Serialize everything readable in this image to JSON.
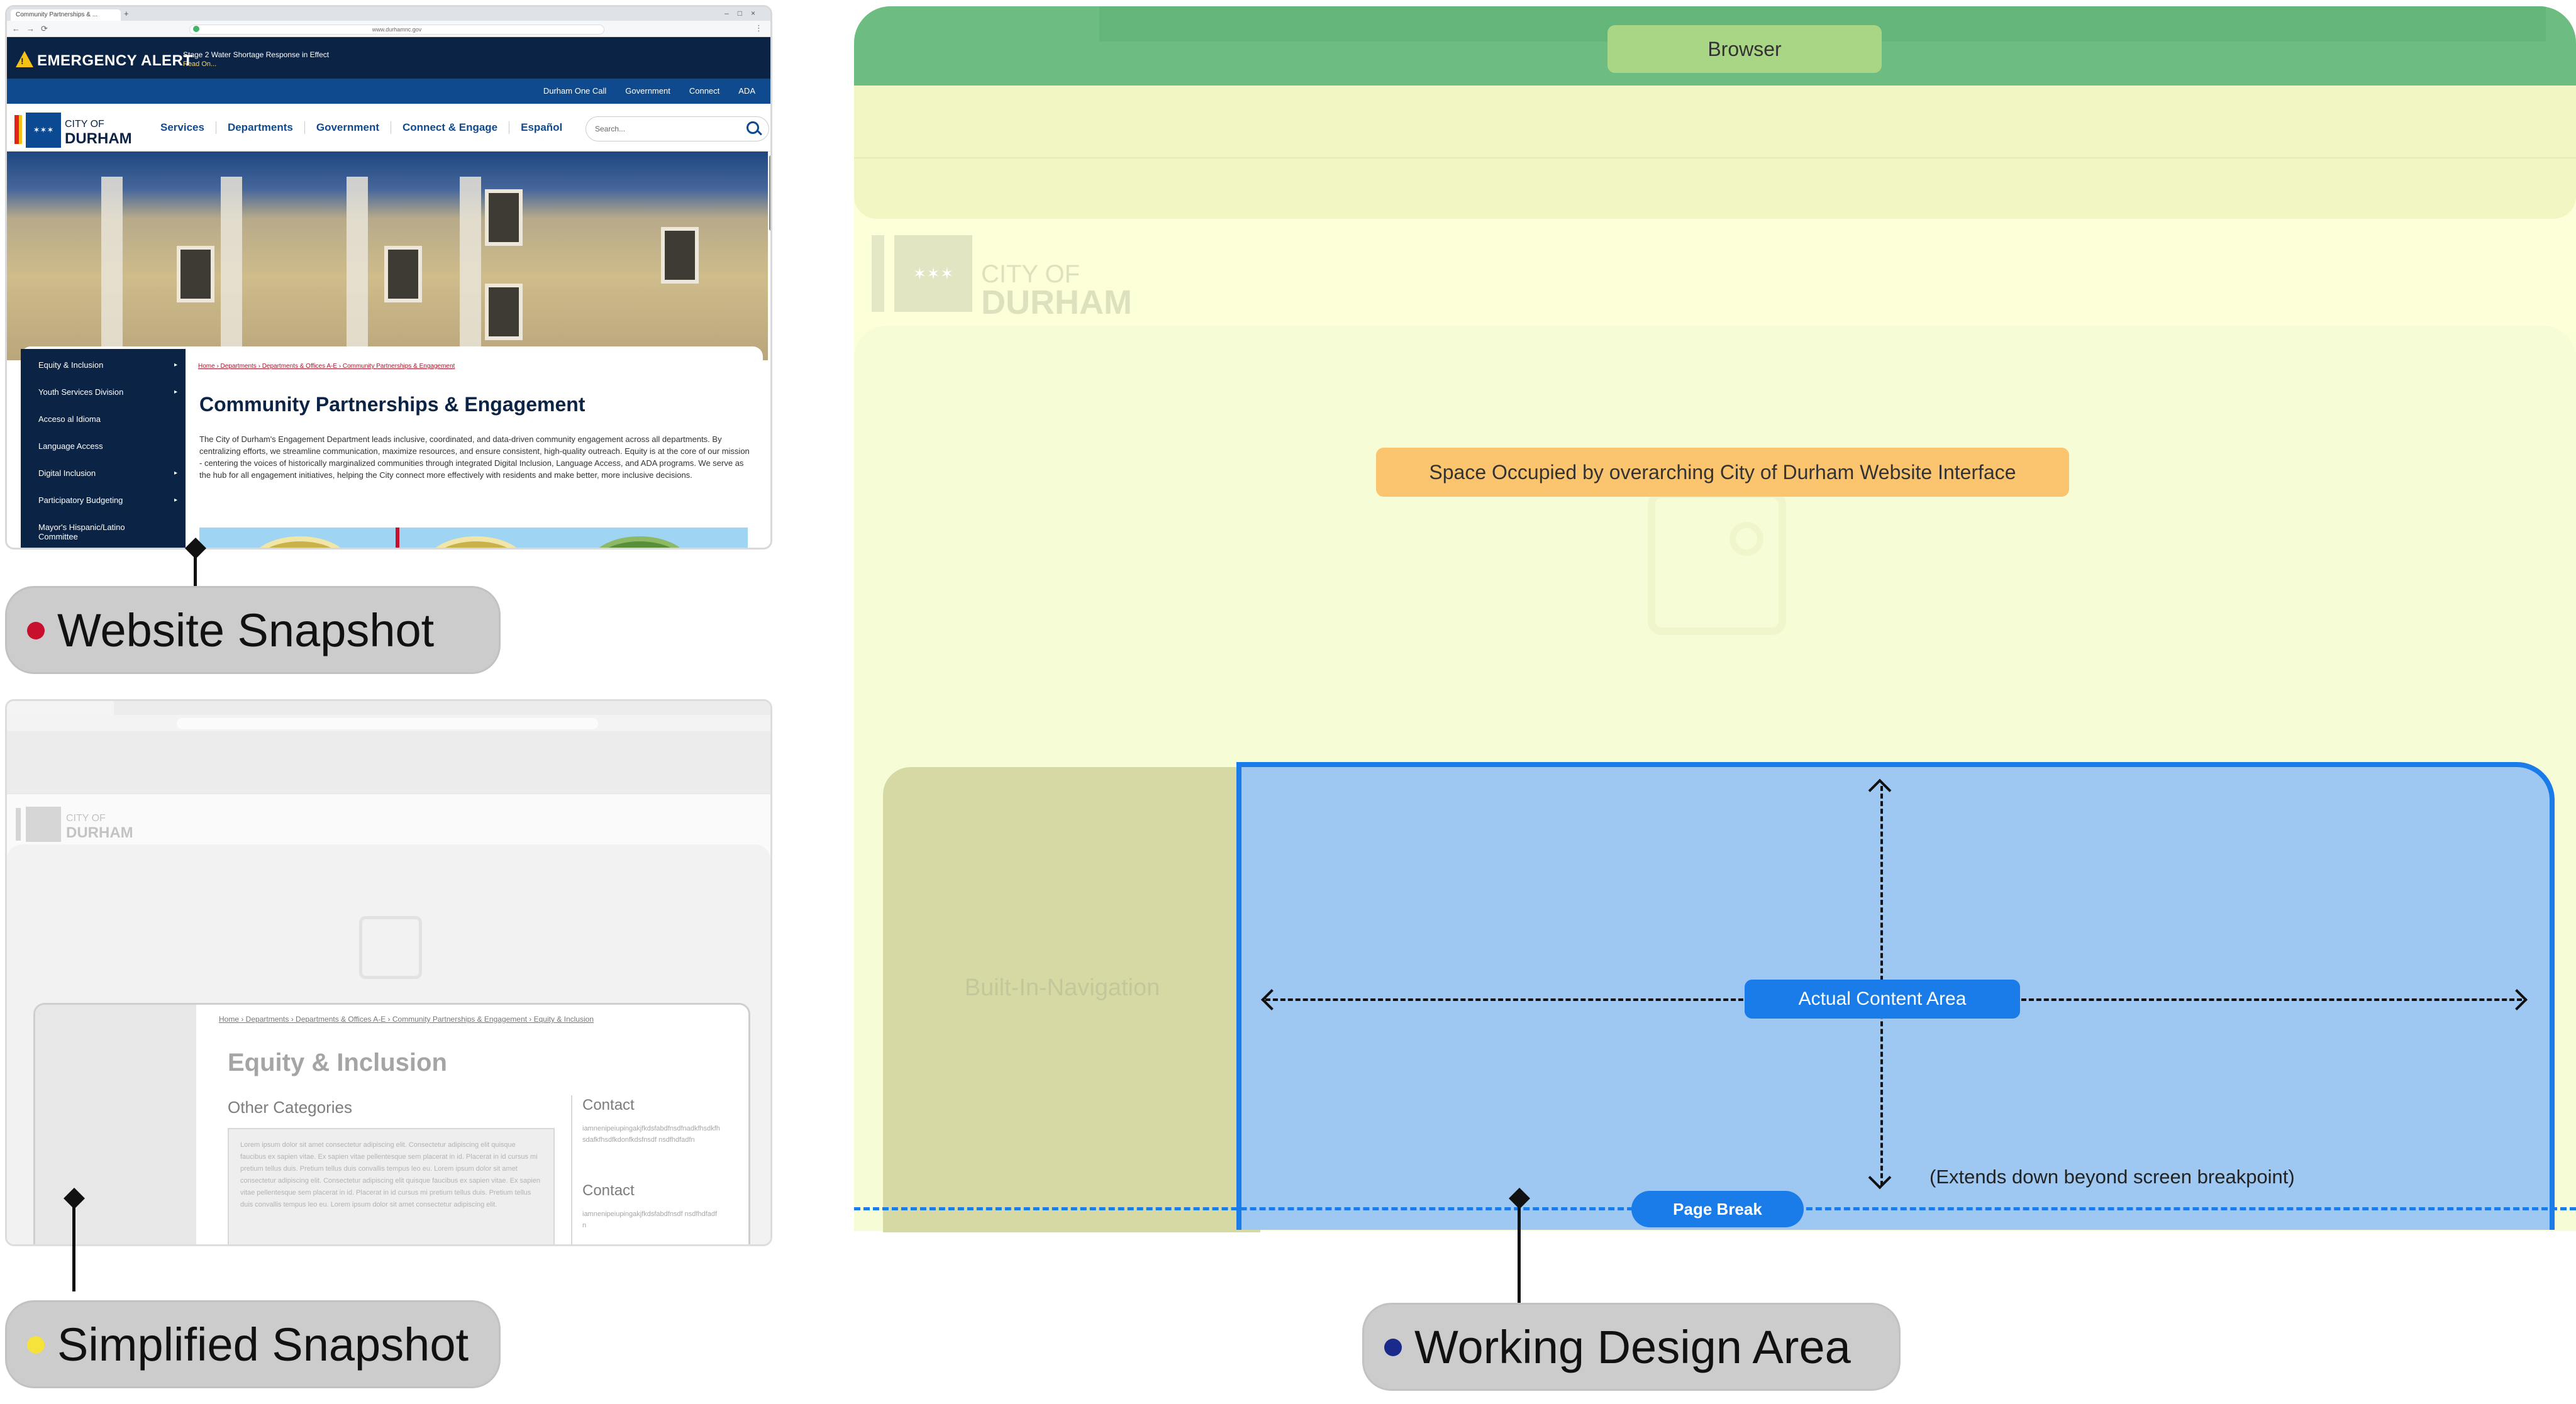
{
  "website_snapshot": {
    "label": "Website Snapshot",
    "dot_color": "#c8102e",
    "browser": {
      "tab_title": "Community Partnerships & ...",
      "url": "www.durhamnc.gov"
    },
    "alert": {
      "title": "EMERGENCY ALERT",
      "message": "Stage 2 Water Shortage Response in Effect",
      "read_on": "Read On..."
    },
    "utility_links": [
      "Durham One Call",
      "Government",
      "Connect",
      "ADA"
    ],
    "logo": {
      "city": "CITY OF",
      "name": "DURHAM"
    },
    "nav_links": [
      "Services",
      "Departments",
      "Government",
      "Connect & Engage",
      "Español"
    ],
    "search_placeholder": "Search...",
    "sidebar_items": [
      {
        "label": "Equity & Inclusion",
        "has_arrow": true
      },
      {
        "label": "Youth Services Division",
        "has_arrow": true
      },
      {
        "label": "Acceso al Idioma",
        "has_arrow": false
      },
      {
        "label": "Language Access",
        "has_arrow": false
      },
      {
        "label": "Digital Inclusion",
        "has_arrow": true
      },
      {
        "label": "Participatory Budgeting",
        "has_arrow": true
      },
      {
        "label": "Mayor's Hispanic/Latino Committee",
        "has_arrow": false
      }
    ],
    "breadcrumb": "Home › Departments › Departments & Offices A-E › Community Partnerships & Engagement",
    "heading": "Community Partnerships & Engagement",
    "paragraph": "The City of Durham's Engagement Department leads inclusive, coordinated, and data-driven community engagement across all departments. By centralizing efforts, we streamline communication, maximize resources, and ensure consistent, high-quality outreach. Equity is at the core of our mission - centering the voices of historically marginalized communities through integrated Digital Inclusion, Language Access, and ADA programs. We serve as the hub for all engagement initiatives, helping the City connect more effectively with residents and make better, more inclusive decisions."
  },
  "simplified_snapshot": {
    "label": "Simplified Snapshot",
    "dot_color": "#f5e23a",
    "logo": {
      "city": "CITY OF",
      "name": "DURHAM"
    },
    "breadcrumb": "Home › Departments › Departments & Offices A-E › Community Partnerships & Engagement › Equity & Inclusion",
    "heading": "Equity & Inclusion",
    "other_categories": "Other Categories",
    "lorem": "Lorem ipsum dolor sit amet consectetur adipiscing elit. Consectetur adipiscing elit quisque faucibus ex sapien vitae. Ex sapien vitae pellentesque sem placerat in id. Placerat in id cursus mi pretium tellus duis. Pretium tellus duis convallis tempus leo eu. Lorem ipsum dolor sit amet consectetur adipiscing elit. Consectetur adipiscing elit quisque faucibus ex sapien vitae. Ex sapien vitae pellentesque sem placerat in id. Placerat in id cursus mi pretium tellus duis. Pretium tellus duis convallis tempus leo eu. Lorem ipsum dolor sit amet consectetur adipiscing elit.",
    "contact_1_title": "Contact",
    "contact_1_text": "iamnenipeiupingakjfkdsfabdfnsdfnadkfhsdkfhsdafkfhsdfkdonfkdsfnsdf nsdfhdfadfn",
    "contact_2_title": "Contact",
    "contact_2_text": "iamnenipeiupingakjfkdsfabdfnsdf nsdfhdfadfn"
  },
  "working_design_area": {
    "label": "Working Design Area",
    "dot_color": "#1a2a8a",
    "browser_label": "Browser",
    "logo": {
      "city": "CITY OF",
      "name": "DURHAM"
    },
    "space_label": "Space Occupied by overarching City of Durham Website Interface",
    "builtin_nav_label": "Built-In-Navigation",
    "content_label": "Actual Content Area",
    "extends_note": "(Extends down beyond screen breakpoint)",
    "page_break_label": "Page Break",
    "colors": {
      "browser": "#6dbd82",
      "website_interface": "#fdffd9",
      "builtin_nav": "#d6d9a4",
      "content_area": "#9ec8f2",
      "content_border": "#1a7ce8"
    }
  }
}
